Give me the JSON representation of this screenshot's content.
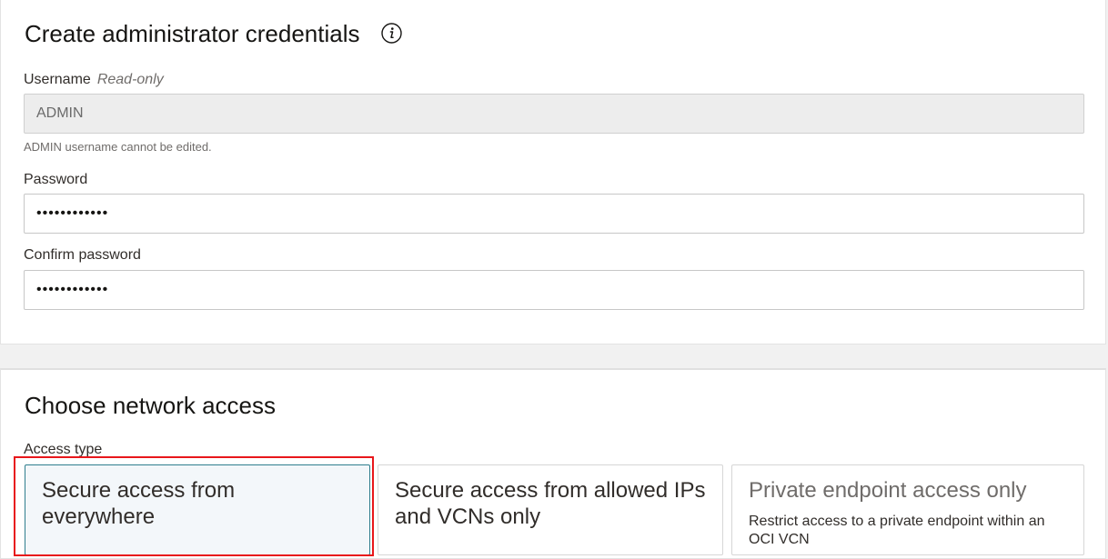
{
  "credentials": {
    "title": "Create administrator credentials",
    "username": {
      "label": "Username",
      "readonly_tag": "Read-only",
      "value": "ADMIN",
      "helper": "ADMIN username cannot be edited."
    },
    "password": {
      "label": "Password",
      "value": "••••••••••••"
    },
    "confirm_password": {
      "label": "Confirm password",
      "value": "••••••••••••"
    }
  },
  "network": {
    "title": "Choose network access",
    "access_type_label": "Access type",
    "options": [
      {
        "title": "Secure access from everywhere",
        "description": "",
        "selected": true
      },
      {
        "title": "Secure access from allowed IPs and VCNs only",
        "description": "",
        "selected": false
      },
      {
        "title": "Private endpoint access only",
        "description": "Restrict access to a private endpoint within an OCI VCN",
        "selected": false
      }
    ]
  },
  "icons": {
    "info": "info-icon"
  },
  "colors": {
    "highlight": "#e8171b",
    "selected_border": "#2f7e8e",
    "selected_bg": "#f3f7fa"
  }
}
